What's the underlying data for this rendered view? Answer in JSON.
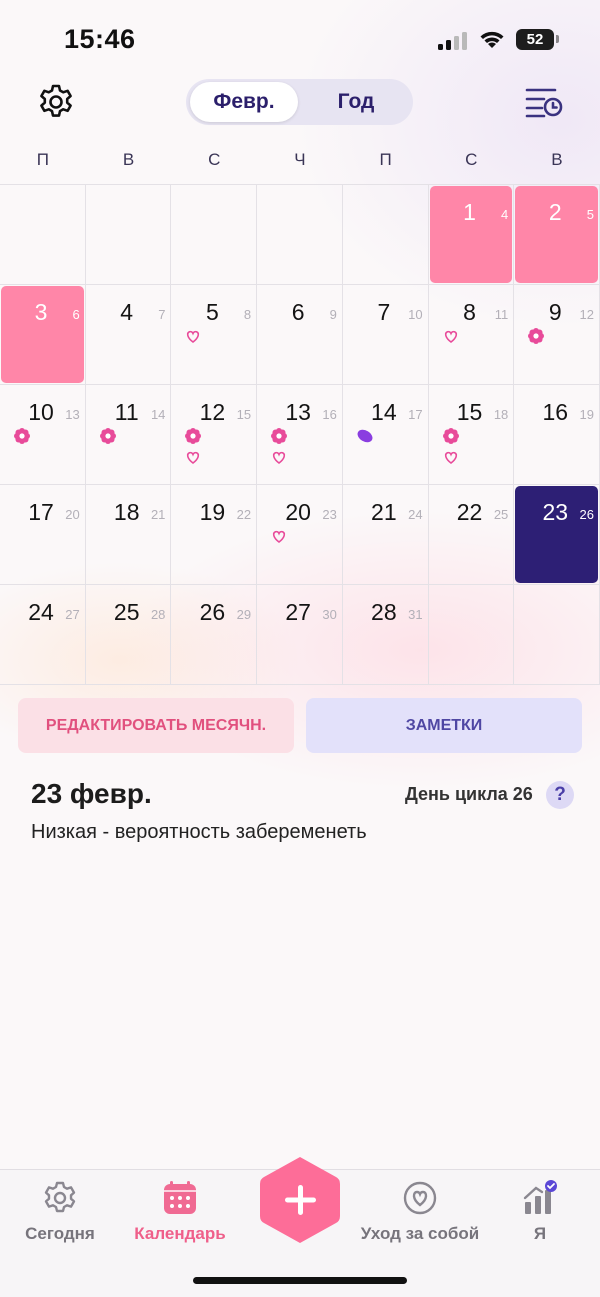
{
  "status_bar": {
    "time": "15:46",
    "battery": "52"
  },
  "header": {
    "tabs": [
      {
        "label": "Февр.",
        "active": true
      },
      {
        "label": "Год",
        "active": false
      }
    ]
  },
  "weekdays": [
    "П",
    "В",
    "С",
    "Ч",
    "П",
    "С",
    "В"
  ],
  "calendar": {
    "leading_empty": 5,
    "trailing_empty": 2,
    "days": [
      {
        "day": "1",
        "cycle": "4",
        "state": "period",
        "marks": []
      },
      {
        "day": "2",
        "cycle": "5",
        "state": "period",
        "marks": []
      },
      {
        "day": "3",
        "cycle": "6",
        "state": "period",
        "marks": []
      },
      {
        "day": "4",
        "cycle": "7",
        "state": "",
        "marks": []
      },
      {
        "day": "5",
        "cycle": "8",
        "state": "",
        "marks": [
          "heart"
        ]
      },
      {
        "day": "6",
        "cycle": "9",
        "state": "",
        "marks": []
      },
      {
        "day": "7",
        "cycle": "10",
        "state": "",
        "marks": []
      },
      {
        "day": "8",
        "cycle": "11",
        "state": "",
        "marks": [
          "heart"
        ]
      },
      {
        "day": "9",
        "cycle": "12",
        "state": "",
        "marks": [
          "flower"
        ]
      },
      {
        "day": "10",
        "cycle": "13",
        "state": "",
        "marks": [
          "flower"
        ]
      },
      {
        "day": "11",
        "cycle": "14",
        "state": "",
        "marks": [
          "flower"
        ]
      },
      {
        "day": "12",
        "cycle": "15",
        "state": "",
        "marks": [
          "flower",
          "heart"
        ]
      },
      {
        "day": "13",
        "cycle": "16",
        "state": "",
        "marks": [
          "flower",
          "heart"
        ]
      },
      {
        "day": "14",
        "cycle": "17",
        "state": "",
        "marks": [
          "pill"
        ]
      },
      {
        "day": "15",
        "cycle": "18",
        "state": "",
        "marks": [
          "flower",
          "heart"
        ]
      },
      {
        "day": "16",
        "cycle": "19",
        "state": "",
        "marks": []
      },
      {
        "day": "17",
        "cycle": "20",
        "state": "",
        "marks": []
      },
      {
        "day": "18",
        "cycle": "21",
        "state": "",
        "marks": []
      },
      {
        "day": "19",
        "cycle": "22",
        "state": "",
        "marks": []
      },
      {
        "day": "20",
        "cycle": "23",
        "state": "",
        "marks": [
          "heart"
        ]
      },
      {
        "day": "21",
        "cycle": "24",
        "state": "",
        "marks": []
      },
      {
        "day": "22",
        "cycle": "25",
        "state": "",
        "marks": []
      },
      {
        "day": "23",
        "cycle": "26",
        "state": "today",
        "marks": []
      },
      {
        "day": "24",
        "cycle": "27",
        "state": "",
        "marks": []
      },
      {
        "day": "25",
        "cycle": "28",
        "state": "",
        "marks": []
      },
      {
        "day": "26",
        "cycle": "29",
        "state": "",
        "marks": []
      },
      {
        "day": "27",
        "cycle": "30",
        "state": "",
        "marks": []
      },
      {
        "day": "28",
        "cycle": "31",
        "state": "",
        "marks": []
      }
    ]
  },
  "actions": {
    "edit_period": "РЕДАКТИРОВАТЬ МЕСЯЧН.",
    "notes": "ЗАМЕТКИ"
  },
  "detail": {
    "date": "23 февр.",
    "cycle_day": "День цикла 26",
    "help": "?",
    "fertility": "Низкая - вероятность забеременеть"
  },
  "nav": {
    "items": [
      {
        "label": "Сегодня",
        "icon": "gear-flower-icon",
        "active": false
      },
      {
        "label": "Календарь",
        "icon": "calendar-icon",
        "active": true
      },
      {
        "label": "Уход за собой",
        "icon": "heart-circle-icon",
        "active": false
      },
      {
        "label": "Я",
        "icon": "stats-icon",
        "active": false
      }
    ]
  },
  "colors": {
    "period": "#ff86a8",
    "today": "#2d1f75",
    "accent": "#ef5f8a",
    "flower": "#e84b9a",
    "pill": "#8a3ee0"
  }
}
